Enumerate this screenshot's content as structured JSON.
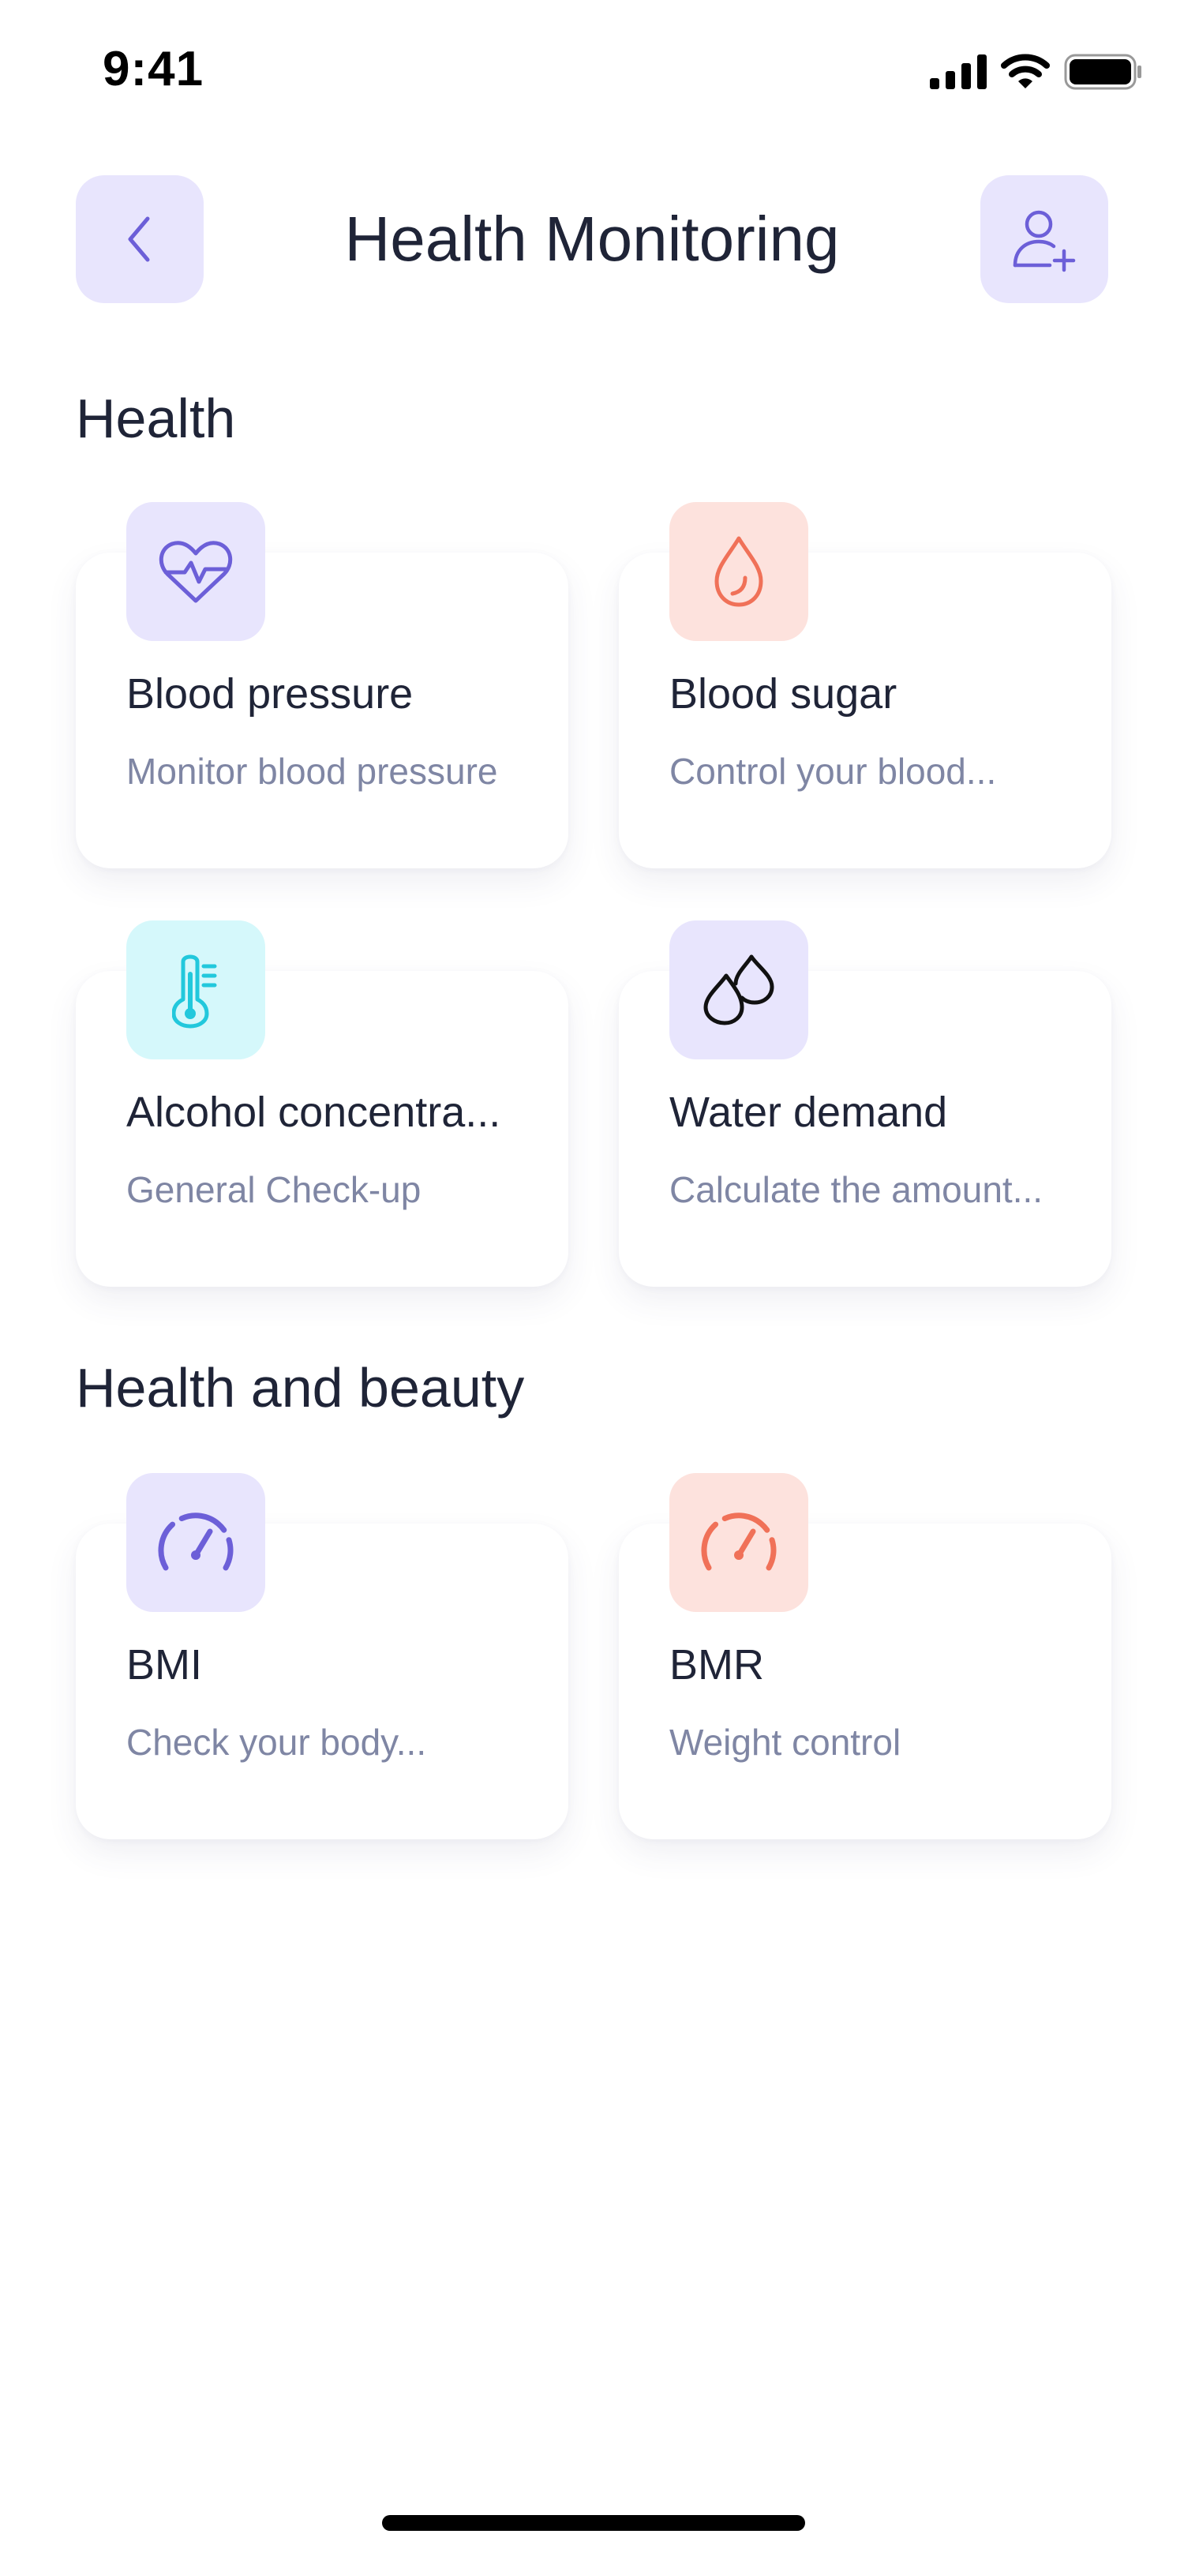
{
  "status_bar": {
    "time": "9:41"
  },
  "header": {
    "title": "Health Monitoring"
  },
  "sections": [
    {
      "title": "Health",
      "cards": [
        {
          "title": "Blood pressure",
          "subtitle": "Monitor blood pressure",
          "icon": "heart-pulse-icon",
          "icon_bg": "#e8e5fd",
          "icon_color": "#6c5fd8"
        },
        {
          "title": "Blood sugar",
          "subtitle": "Control your blood...",
          "icon": "drop-icon",
          "icon_bg": "#fde2dd",
          "icon_color": "#f07158"
        },
        {
          "title": "Alcohol concentra...",
          "subtitle": "General Check-up",
          "icon": "thermometer-icon",
          "icon_bg": "#d5f8fb",
          "icon_color": "#22c8dc"
        },
        {
          "title": "Water demand",
          "subtitle": "Calculate the amount...",
          "icon": "water-drops-icon",
          "icon_bg": "#e8e5fd",
          "icon_color": "#111111"
        }
      ]
    },
    {
      "title": "Health and beauty",
      "cards": [
        {
          "title": "BMI",
          "subtitle": "Check your body...",
          "icon": "gauge-icon",
          "icon_bg": "#e8e5fd",
          "icon_color": "#6c5fd8"
        },
        {
          "title": "BMR",
          "subtitle": "Weight control",
          "icon": "gauge-icon",
          "icon_bg": "#fde2dd",
          "icon_color": "#f07158"
        }
      ]
    }
  ]
}
